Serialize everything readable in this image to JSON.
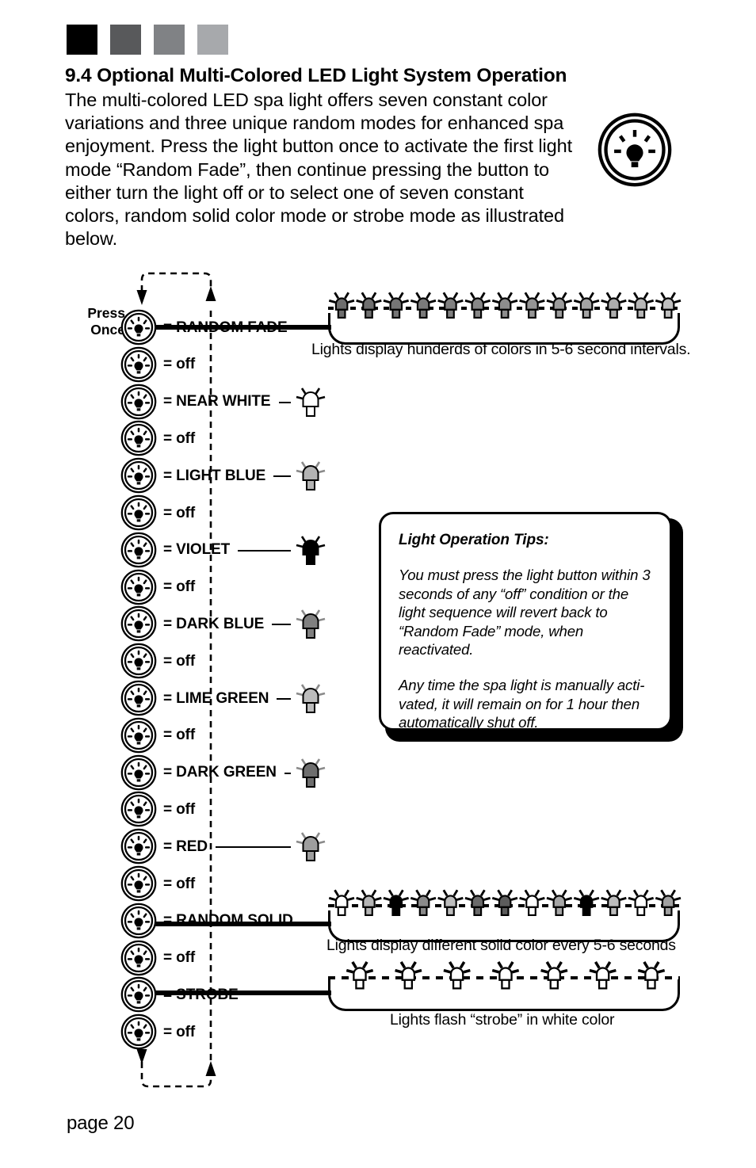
{
  "swatches": [
    {
      "name": "swatch-black",
      "color": "#000000"
    },
    {
      "name": "swatch-dark-gray",
      "color": "#58595b"
    },
    {
      "name": "swatch-mid-gray",
      "color": "#808285"
    },
    {
      "name": "swatch-light-gray",
      "color": "#a7a9ac"
    }
  ],
  "heading": "9.4 Optional Multi-Colored LED Light System Operation",
  "intro": "The multi-colored LED spa light offers seven constant color variations and three unique random modes for enhanced spa enjoyment.  Press the light button once to activate the first light mode “Random Fade”, then continue pressing the button to either turn the light off or to select one of seven constant colors, random solid color mode or strobe mode as illustrated below.",
  "press_once": "Press\nOnce",
  "sequence": [
    {
      "label": "= RANDOM FADE",
      "kind": "mode",
      "lamp": null,
      "leader": false
    },
    {
      "label": "= off",
      "kind": "off",
      "lamp": null,
      "leader": false
    },
    {
      "label": "= NEAR WHITE",
      "kind": "color",
      "lamp": "#ffffff",
      "leader": true
    },
    {
      "label": "= off",
      "kind": "off",
      "lamp": null,
      "leader": false
    },
    {
      "label": "= LIGHT BLUE",
      "kind": "color",
      "lamp": "#b3b3b3",
      "leader": true
    },
    {
      "label": "= off",
      "kind": "off",
      "lamp": null,
      "leader": false
    },
    {
      "label": "= VIOLET",
      "kind": "color",
      "lamp": "#000000",
      "leader": true
    },
    {
      "label": "= off",
      "kind": "off",
      "lamp": null,
      "leader": false
    },
    {
      "label": "= DARK BLUE",
      "kind": "color",
      "lamp": "#808080",
      "leader": true
    },
    {
      "label": "= off",
      "kind": "off",
      "lamp": null,
      "leader": false
    },
    {
      "label": "= LIME GREEN",
      "kind": "color",
      "lamp": "#bcbcbc",
      "leader": true
    },
    {
      "label": "= off",
      "kind": "off",
      "lamp": null,
      "leader": false
    },
    {
      "label": "= DARK GREEN",
      "kind": "color",
      "lamp": "#6e6e6e",
      "leader": true
    },
    {
      "label": "= off",
      "kind": "off",
      "lamp": null,
      "leader": false
    },
    {
      "label": "= RED",
      "kind": "color",
      "lamp": "#9e9e9e",
      "leader": true
    },
    {
      "label": "= off",
      "kind": "off",
      "lamp": null,
      "leader": false
    },
    {
      "label": "= RANDOM SOLID",
      "kind": "mode",
      "lamp": null,
      "leader": false
    },
    {
      "label": "= off",
      "kind": "off",
      "lamp": null,
      "leader": false
    },
    {
      "label": "= STROBE",
      "kind": "mode",
      "lamp": null,
      "leader": false
    },
    {
      "label": "= off",
      "kind": "off",
      "lamp": null,
      "leader": false
    }
  ],
  "tips": {
    "title": "Light Operation Tips:",
    "paragraph1": "You must press the light button within 3 seconds of any “off” condition or the light sequence will revert back to “Random Fade” mode, when reactivated.",
    "paragraph2": "Any time the spa light is manually acti-vated, it will remain on for 1 hour then automatically shut off."
  },
  "strips": {
    "random_fade": {
      "caption": "Lights display hunderds of colors in 5-6 second intervals.",
      "lamp_colors": [
        "#6d6d6d",
        "#6f6f6f",
        "#757575",
        "#7a7a7a",
        "#808080",
        "#878787",
        "#8d8d8d",
        "#949494",
        "#9b9b9b",
        "#a4a4a4",
        "#adadad",
        "#b6b6b6",
        "#bfbfbf"
      ]
    },
    "random_solid": {
      "caption": "Lights display different solid color every 5-6 seconds",
      "lamp_colors": [
        "#ffffff",
        "#b5b5b5",
        "#000000",
        "#8a8a8a",
        "#bdbdbd",
        "#6a6a6a",
        "#5c5c5c",
        "#ffffff",
        "#a6a6a6",
        "#000000",
        "#bdbdbd",
        "#ffffff",
        "#a0a0a0"
      ]
    },
    "strobe": {
      "caption": "Lights flash “strobe” in white color",
      "lamp_colors": [
        "#ffffff",
        "#ffffff",
        "#ffffff",
        "#ffffff",
        "#ffffff",
        "#ffffff",
        "#ffffff"
      ]
    }
  },
  "page_number": "page 20"
}
